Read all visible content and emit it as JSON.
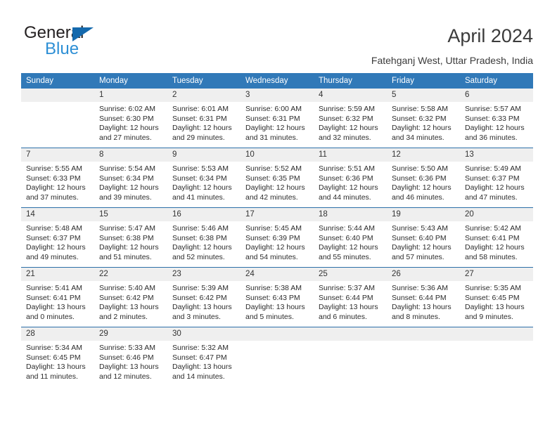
{
  "brand": {
    "general": "General",
    "blue": "Blue",
    "triangle_color": "#1469ad",
    "blue_color": "#2d8fd5"
  },
  "header": {
    "title": "April 2024",
    "subtitle": "Fatehganj West, Uttar Pradesh, India"
  },
  "theme": {
    "header_bg": "#3179b8",
    "daynum_bg": "#efefef",
    "row_divider": "#2c6fa8"
  },
  "weekday_headers": [
    "Sunday",
    "Monday",
    "Tuesday",
    "Wednesday",
    "Thursday",
    "Friday",
    "Saturday"
  ],
  "weeks": [
    [
      {
        "day": "",
        "lines": []
      },
      {
        "day": "1",
        "lines": [
          "Sunrise: 6:02 AM",
          "Sunset: 6:30 PM",
          "Daylight: 12 hours",
          "and 27 minutes."
        ]
      },
      {
        "day": "2",
        "lines": [
          "Sunrise: 6:01 AM",
          "Sunset: 6:31 PM",
          "Daylight: 12 hours",
          "and 29 minutes."
        ]
      },
      {
        "day": "3",
        "lines": [
          "Sunrise: 6:00 AM",
          "Sunset: 6:31 PM",
          "Daylight: 12 hours",
          "and 31 minutes."
        ]
      },
      {
        "day": "4",
        "lines": [
          "Sunrise: 5:59 AM",
          "Sunset: 6:32 PM",
          "Daylight: 12 hours",
          "and 32 minutes."
        ]
      },
      {
        "day": "5",
        "lines": [
          "Sunrise: 5:58 AM",
          "Sunset: 6:32 PM",
          "Daylight: 12 hours",
          "and 34 minutes."
        ]
      },
      {
        "day": "6",
        "lines": [
          "Sunrise: 5:57 AM",
          "Sunset: 6:33 PM",
          "Daylight: 12 hours",
          "and 36 minutes."
        ]
      }
    ],
    [
      {
        "day": "7",
        "lines": [
          "Sunrise: 5:55 AM",
          "Sunset: 6:33 PM",
          "Daylight: 12 hours",
          "and 37 minutes."
        ]
      },
      {
        "day": "8",
        "lines": [
          "Sunrise: 5:54 AM",
          "Sunset: 6:34 PM",
          "Daylight: 12 hours",
          "and 39 minutes."
        ]
      },
      {
        "day": "9",
        "lines": [
          "Sunrise: 5:53 AM",
          "Sunset: 6:34 PM",
          "Daylight: 12 hours",
          "and 41 minutes."
        ]
      },
      {
        "day": "10",
        "lines": [
          "Sunrise: 5:52 AM",
          "Sunset: 6:35 PM",
          "Daylight: 12 hours",
          "and 42 minutes."
        ]
      },
      {
        "day": "11",
        "lines": [
          "Sunrise: 5:51 AM",
          "Sunset: 6:36 PM",
          "Daylight: 12 hours",
          "and 44 minutes."
        ]
      },
      {
        "day": "12",
        "lines": [
          "Sunrise: 5:50 AM",
          "Sunset: 6:36 PM",
          "Daylight: 12 hours",
          "and 46 minutes."
        ]
      },
      {
        "day": "13",
        "lines": [
          "Sunrise: 5:49 AM",
          "Sunset: 6:37 PM",
          "Daylight: 12 hours",
          "and 47 minutes."
        ]
      }
    ],
    [
      {
        "day": "14",
        "lines": [
          "Sunrise: 5:48 AM",
          "Sunset: 6:37 PM",
          "Daylight: 12 hours",
          "and 49 minutes."
        ]
      },
      {
        "day": "15",
        "lines": [
          "Sunrise: 5:47 AM",
          "Sunset: 6:38 PM",
          "Daylight: 12 hours",
          "and 51 minutes."
        ]
      },
      {
        "day": "16",
        "lines": [
          "Sunrise: 5:46 AM",
          "Sunset: 6:38 PM",
          "Daylight: 12 hours",
          "and 52 minutes."
        ]
      },
      {
        "day": "17",
        "lines": [
          "Sunrise: 5:45 AM",
          "Sunset: 6:39 PM",
          "Daylight: 12 hours",
          "and 54 minutes."
        ]
      },
      {
        "day": "18",
        "lines": [
          "Sunrise: 5:44 AM",
          "Sunset: 6:40 PM",
          "Daylight: 12 hours",
          "and 55 minutes."
        ]
      },
      {
        "day": "19",
        "lines": [
          "Sunrise: 5:43 AM",
          "Sunset: 6:40 PM",
          "Daylight: 12 hours",
          "and 57 minutes."
        ]
      },
      {
        "day": "20",
        "lines": [
          "Sunrise: 5:42 AM",
          "Sunset: 6:41 PM",
          "Daylight: 12 hours",
          "and 58 minutes."
        ]
      }
    ],
    [
      {
        "day": "21",
        "lines": [
          "Sunrise: 5:41 AM",
          "Sunset: 6:41 PM",
          "Daylight: 13 hours",
          "and 0 minutes."
        ]
      },
      {
        "day": "22",
        "lines": [
          "Sunrise: 5:40 AM",
          "Sunset: 6:42 PM",
          "Daylight: 13 hours",
          "and 2 minutes."
        ]
      },
      {
        "day": "23",
        "lines": [
          "Sunrise: 5:39 AM",
          "Sunset: 6:42 PM",
          "Daylight: 13 hours",
          "and 3 minutes."
        ]
      },
      {
        "day": "24",
        "lines": [
          "Sunrise: 5:38 AM",
          "Sunset: 6:43 PM",
          "Daylight: 13 hours",
          "and 5 minutes."
        ]
      },
      {
        "day": "25",
        "lines": [
          "Sunrise: 5:37 AM",
          "Sunset: 6:44 PM",
          "Daylight: 13 hours",
          "and 6 minutes."
        ]
      },
      {
        "day": "26",
        "lines": [
          "Sunrise: 5:36 AM",
          "Sunset: 6:44 PM",
          "Daylight: 13 hours",
          "and 8 minutes."
        ]
      },
      {
        "day": "27",
        "lines": [
          "Sunrise: 5:35 AM",
          "Sunset: 6:45 PM",
          "Daylight: 13 hours",
          "and 9 minutes."
        ]
      }
    ],
    [
      {
        "day": "28",
        "lines": [
          "Sunrise: 5:34 AM",
          "Sunset: 6:45 PM",
          "Daylight: 13 hours",
          "and 11 minutes."
        ]
      },
      {
        "day": "29",
        "lines": [
          "Sunrise: 5:33 AM",
          "Sunset: 6:46 PM",
          "Daylight: 13 hours",
          "and 12 minutes."
        ]
      },
      {
        "day": "30",
        "lines": [
          "Sunrise: 5:32 AM",
          "Sunset: 6:47 PM",
          "Daylight: 13 hours",
          "and 14 minutes."
        ]
      },
      {
        "day": "",
        "lines": []
      },
      {
        "day": "",
        "lines": []
      },
      {
        "day": "",
        "lines": []
      },
      {
        "day": "",
        "lines": []
      }
    ]
  ]
}
